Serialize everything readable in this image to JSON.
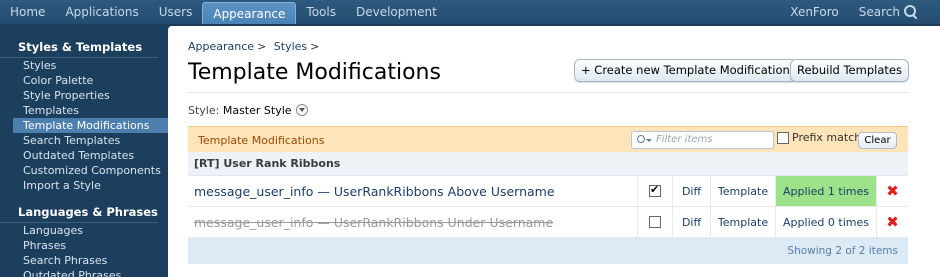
{
  "topnav": {
    "tabs": [
      "Home",
      "Applications",
      "Users",
      "Appearance",
      "Tools",
      "Development"
    ],
    "active": "Appearance",
    "right_link": "XenForo",
    "search_label": "Search"
  },
  "sidebar": {
    "sections": [
      {
        "title": "Styles & Templates",
        "items": [
          "Styles",
          "Color Palette",
          "Style Properties",
          "Templates",
          "Template Modifications",
          "Search Templates",
          "Outdated Templates",
          "Customized Components",
          "Import a Style"
        ]
      },
      {
        "title": "Languages & Phrases",
        "items": [
          "Languages",
          "Phrases",
          "Search Phrases",
          "Outdated Phrases"
        ]
      }
    ],
    "active_item": "Template Modifications"
  },
  "breadcrumb": [
    "Appearance",
    "Styles"
  ],
  "page_title": "Template Modifications",
  "buttons": {
    "create": "+ Create new Template Modification",
    "rebuild": "Rebuild Templates"
  },
  "style_selector": {
    "label": "Style:",
    "value": "Master Style"
  },
  "list": {
    "header": "Template Modifications",
    "filter_placeholder": "Filter items",
    "prefix_label": "Prefix match",
    "clear_label": "Clear",
    "group": "[RT] User Rank Ribbons",
    "rows": [
      {
        "name": "message_user_info — UserRankRibbons Above Username",
        "enabled": true,
        "diff": "Diff",
        "template": "Template",
        "applied": "Applied 1 times"
      },
      {
        "name": "message_user_info — UserRankRibbons Under Username",
        "enabled": false,
        "diff": "Diff",
        "template": "Template",
        "applied": "Applied 0 times"
      }
    ],
    "footer": "Showing 2 of 2 items"
  }
}
